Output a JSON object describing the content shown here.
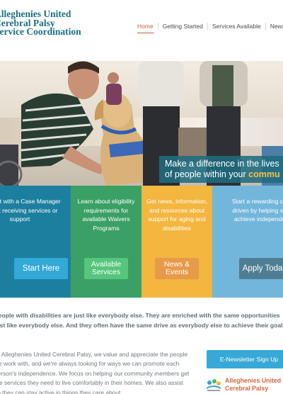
{
  "site": {
    "logo_lines": [
      "Alleghenies United",
      "Cerebral Palsy",
      "Service Coordination"
    ]
  },
  "nav": {
    "items": [
      "Home",
      "Getting Started",
      "Services Available",
      "News"
    ],
    "active": "Home"
  },
  "hero": {
    "tagline_line1": "Make a difference in the lives",
    "tagline_line2_prefix": "of people within your ",
    "tagline_line2_highlight": "commu"
  },
  "tiles": [
    {
      "text": "Connect with a Case Manager to start receiving services or support",
      "button": "Start Here",
      "color": "#1d7fa0",
      "button_color": "#32a9d7"
    },
    {
      "text": "Learn about eligibility requirements for available Waivers Programs",
      "button": "Available Services",
      "color": "#3ba065",
      "button_color": "#56c57d"
    },
    {
      "text": "Get news, information, and resources about support for aging and disabilities",
      "button": "News & Events",
      "color": "#f3b63f",
      "button_color": "#e69a4a"
    },
    {
      "text": "Start a rewarding career driven by helping others achieve independence",
      "button": "Apply Today",
      "color": "#73b6dc",
      "button_color": "#4f7e94"
    }
  ],
  "lead": {
    "line1": "People with disabilities are just like everybody else. They are enriched with the same opportunities",
    "line2": "just like everybody else. And they often have the same drive as everybody else to achieve their goals."
  },
  "body_copy": {
    "lines": [
      "At Alleghenies United Cerebral Palsy, we value and appreciate the people",
      "we work with, and we're always looking for ways we can promote each",
      "person's independence. We focus on helping our community members get",
      "the services they need to live comfortably in their homes. We also assist",
      "so they can stay active in things they care about."
    ]
  },
  "sidebar": {
    "enews_label": "E-Newsletter Sign Up",
    "mini_title_lines": [
      "Alleghenies United",
      "Cerebral Palsy"
    ]
  },
  "colors": {
    "brand_teal": "#1a6f86",
    "nav_active": "#c0624a",
    "highlight_yellow": "#f5c14f"
  }
}
